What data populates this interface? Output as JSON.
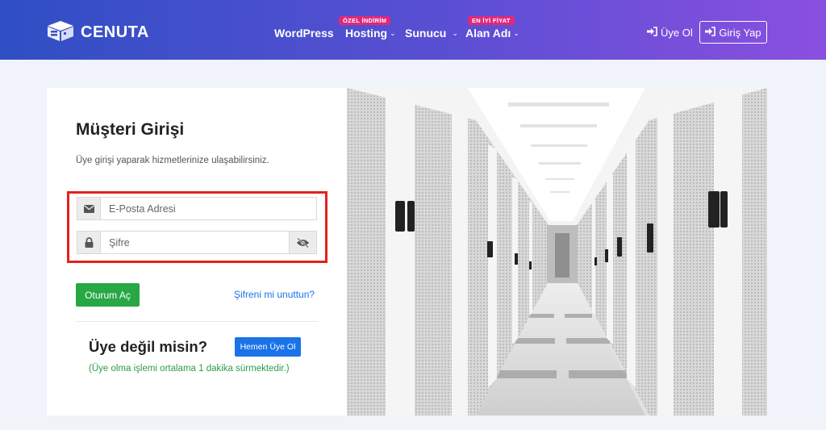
{
  "brand": {
    "name": "CENUTA",
    "logo_icon": "cube-box-icon"
  },
  "nav": {
    "items": [
      {
        "label": "WordPress",
        "badge": "",
        "has_dropdown": false
      },
      {
        "label": "Hosting",
        "badge": "ÖZEL İNDİRİM",
        "has_dropdown": true
      },
      {
        "label": "Sunucu",
        "badge": "",
        "has_dropdown": true
      },
      {
        "label": "Alan Adı",
        "badge": "EN İYİ FİYAT",
        "has_dropdown": true
      }
    ],
    "register_label": "Üye Ol",
    "login_label": "Giriş Yap",
    "chevron": "⌄"
  },
  "login": {
    "title": "Müşteri Girişi",
    "subtitle": "Üye girişi yaparak hizmetlerinize ulaşabilirsiniz.",
    "email_placeholder": "E-Posta Adresi",
    "email_value": "",
    "password_placeholder": "Şifre",
    "password_value": "",
    "submit_label": "Oturum Aç",
    "forgot_label": "Şifreni mi unuttun?"
  },
  "signup": {
    "heading": "Üye değil misin?",
    "button_label": "Hemen Üye Ol",
    "note": "(Üye olma işlemi ortalama 1 dakika sürmektedir.)"
  },
  "colors": {
    "nav_gradient_start": "#2f4fc4",
    "nav_gradient_end": "#8a4fe0",
    "badge": "#e0287a",
    "highlight_border": "#e4211c",
    "submit": "#28a745",
    "link": "#1a73e8",
    "note": "#2e9c46"
  }
}
